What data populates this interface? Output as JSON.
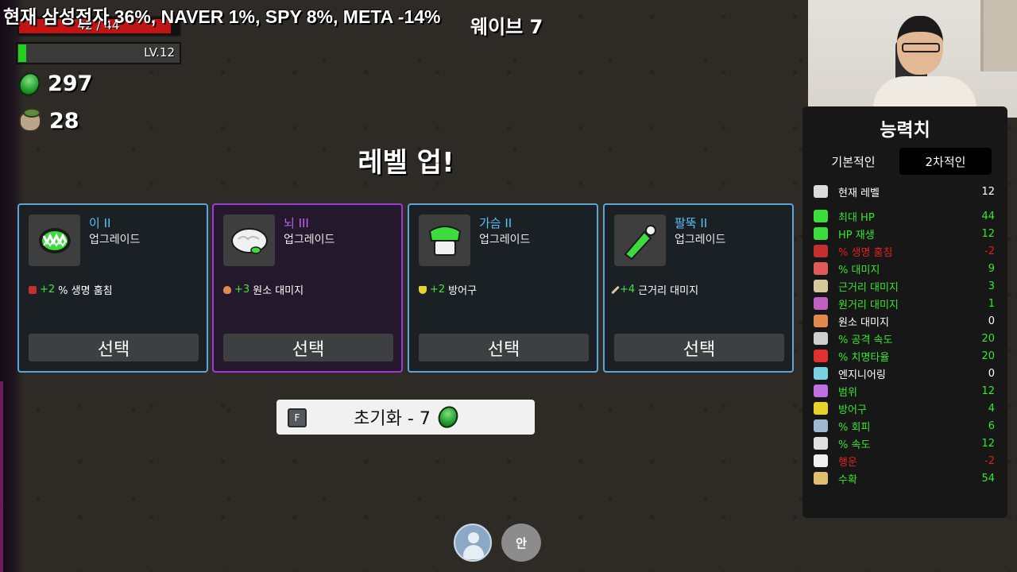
{
  "hud": {
    "ticker": "현재 삼성전자 36%, NAVER 1%, SPY 8%, META -14%",
    "wave": "웨이브 7",
    "hp": "42 / 44",
    "hp_fraction": 0.955,
    "level": "LV.12",
    "xp_fraction": 0.05,
    "materials": "297",
    "bag": "28"
  },
  "levelup": {
    "title": "레벨 업!",
    "cards": [
      {
        "name": "이 II",
        "subtitle": "업그레이드",
        "bonus": "+2",
        "effect": "% 생명 훔침",
        "button": "선택",
        "rarity": "blue"
      },
      {
        "name": "뇌 III",
        "subtitle": "업그레이드",
        "bonus": "+3",
        "effect": "원소 대미지",
        "button": "선택",
        "rarity": "purple"
      },
      {
        "name": "가슴 II",
        "subtitle": "업그레이드",
        "bonus": "+2",
        "effect": "방어구",
        "button": "선택",
        "rarity": "blue"
      },
      {
        "name": "팔뚝 II",
        "subtitle": "업그레이드",
        "bonus": "+4",
        "effect": "근거리 대미지",
        "button": "선택",
        "rarity": "blue"
      }
    ],
    "reroll_key": "F",
    "reroll_label": "초기화 - 7"
  },
  "bottom": {
    "an_label": "안"
  },
  "stats": {
    "title": "능력치",
    "tab_basic": "기본적인",
    "tab_second": "2차적인",
    "rows": [
      {
        "name": "현재 레벨",
        "value": "12",
        "color": "white",
        "icon": "skull-icon"
      },
      {
        "name": "최대 HP",
        "value": "44",
        "color": "green",
        "icon": "heart-icon"
      },
      {
        "name": "HP 재생",
        "value": "12",
        "color": "green",
        "icon": "heart-plus-icon"
      },
      {
        "name": "% 생명 훔침",
        "value": "-2",
        "color": "red",
        "icon": "teeth-icon"
      },
      {
        "name": "% 대미지",
        "value": "9",
        "color": "green",
        "icon": "muscle-icon"
      },
      {
        "name": "근거리 대미지",
        "value": "3",
        "color": "green",
        "icon": "sword-icon"
      },
      {
        "name": "원거리 대미지",
        "value": "1",
        "color": "green",
        "icon": "bow-icon"
      },
      {
        "name": "원소 대미지",
        "value": "0",
        "color": "white",
        "icon": "flame-icon"
      },
      {
        "name": "% 공격 속도",
        "value": "20",
        "color": "green",
        "icon": "hourglass-icon"
      },
      {
        "name": "% 치명타율",
        "value": "20",
        "color": "green",
        "icon": "crit-icon"
      },
      {
        "name": "엔지니어링",
        "value": "0",
        "color": "white",
        "icon": "wrench-icon"
      },
      {
        "name": "범위",
        "value": "12",
        "color": "green",
        "icon": "range-icon"
      },
      {
        "name": "방어구",
        "value": "4",
        "color": "green",
        "icon": "shield-icon"
      },
      {
        "name": "% 회피",
        "value": "6",
        "color": "green",
        "icon": "dodge-icon"
      },
      {
        "name": "% 속도",
        "value": "12",
        "color": "green",
        "icon": "shoe-icon"
      },
      {
        "name": "행운",
        "value": "-2",
        "color": "red",
        "icon": "dice-icon"
      },
      {
        "name": "수확",
        "value": "54",
        "color": "green",
        "icon": "wheat-icon"
      }
    ]
  },
  "colors": {
    "hp": "#c21414",
    "xp": "#22d11f",
    "blue_rarity": "#5aa6d9",
    "purple_rarity": "#a03ad6",
    "positive": "#39e52f",
    "negative": "#e02020"
  }
}
